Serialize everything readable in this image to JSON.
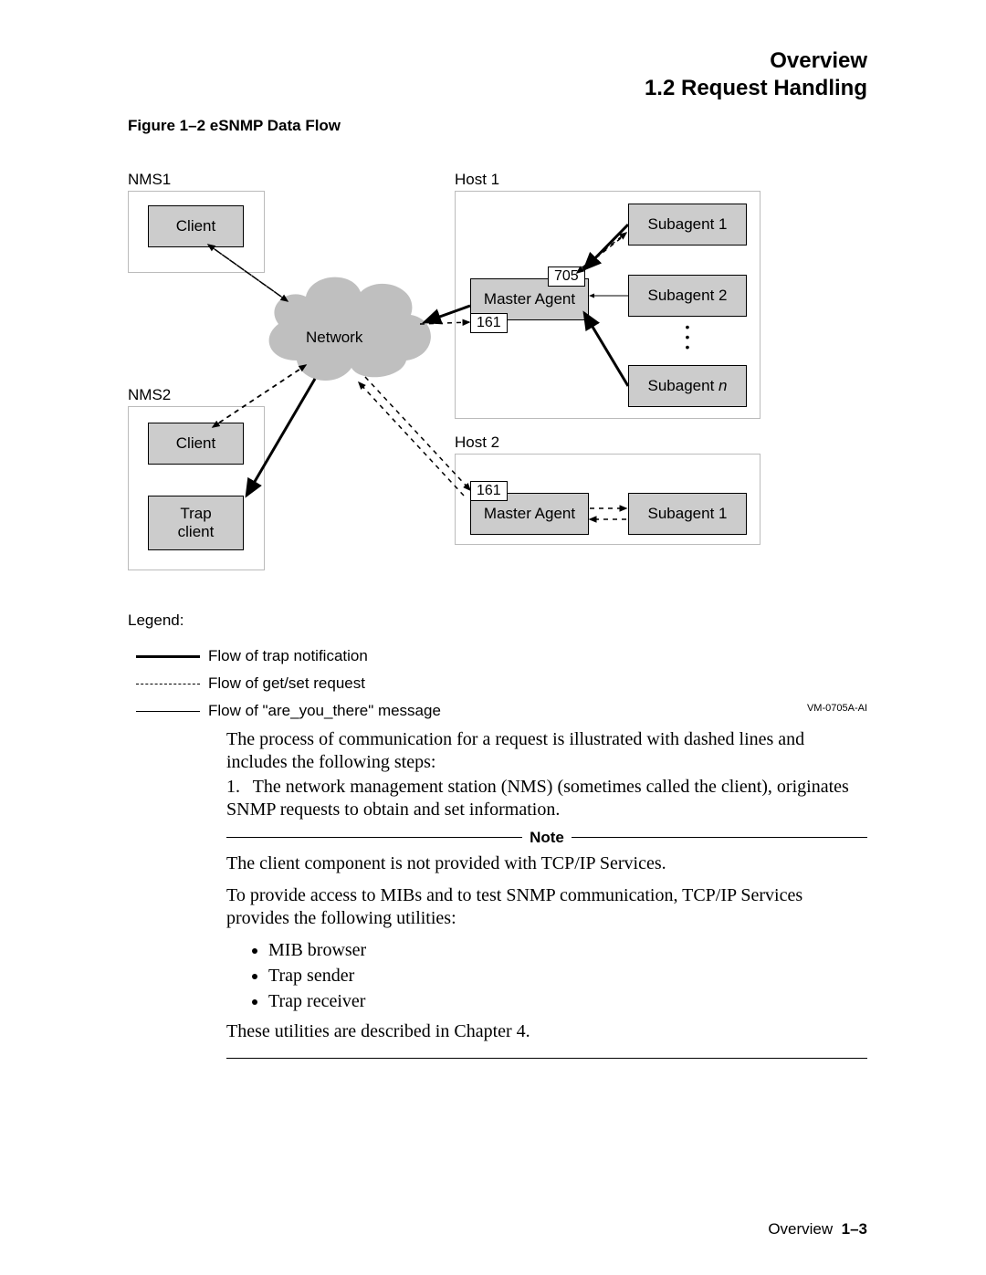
{
  "header": {
    "line1": "Overview",
    "line2": "1.2 Request Handling"
  },
  "figure": {
    "caption": "Figure 1–2   eSNMP Data Flow",
    "ref": "VM-0705A-AI"
  },
  "diagram": {
    "nms1_label": "NMS1",
    "nms2_label": "NMS2",
    "host1_label": "Host 1",
    "host2_label": "Host 2",
    "client": "Client",
    "trap_client_line1": "Trap",
    "trap_client_line2": "client",
    "network": "Network",
    "master_agent": "Master Agent",
    "subagent1": "Subagent 1",
    "subagent2": "Subagent 2",
    "subagent_n": "Subagent n",
    "port_705": "705",
    "port_161": "161"
  },
  "legend": {
    "title": "Legend:",
    "row_trap": "Flow of trap notification",
    "row_getset": "Flow of get/set request",
    "row_ayt": "Flow of \"are_you_there\" message"
  },
  "body": {
    "intro": "The process of communication for a request is illustrated with dashed lines and includes the following steps:",
    "step1_num": "1.",
    "step1": "The network management station (NMS) (sometimes called the client), originates SNMP requests to obtain and set information.",
    "note_label": "Note",
    "note_p1": "The client component is not provided with TCP/IP Services.",
    "note_p2": "To provide access to MIBs and to test SNMP communication, TCP/IP Services provides the following utilities:",
    "bullets": [
      "MIB browser",
      "Trap sender",
      "Trap receiver"
    ],
    "note_p3": "These utilities are described in Chapter 4."
  },
  "footer": {
    "text": "Overview",
    "page": "1–3"
  }
}
